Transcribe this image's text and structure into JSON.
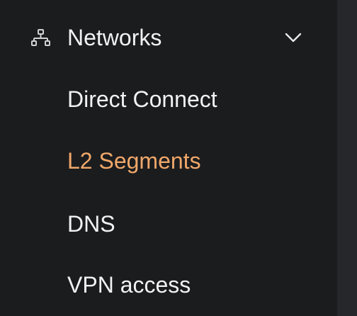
{
  "sidebar": {
    "group": {
      "label": "Networks",
      "icon": "network-icon",
      "expanded": true
    },
    "items": [
      {
        "label": "Direct Connect",
        "active": false
      },
      {
        "label": "L2 Segments",
        "active": true
      },
      {
        "label": "DNS",
        "active": false
      },
      {
        "label": "VPN access",
        "active": false
      }
    ]
  },
  "colors": {
    "background": "#1b1c1e",
    "text": "#f2f2f2",
    "accent": "#f0a86a",
    "icon": "#cfd1d4"
  }
}
